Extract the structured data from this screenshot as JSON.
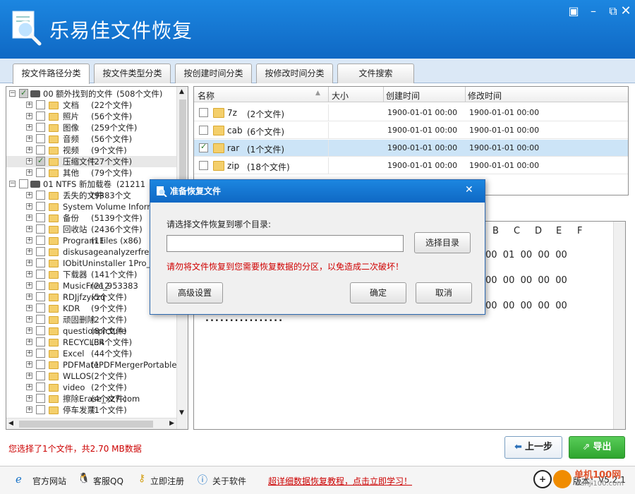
{
  "app": {
    "title": "乐易佳文件恢复"
  },
  "tabs": [
    "按文件路径分类",
    "按文件类型分类",
    "按创建时间分类",
    "按修改时间分类",
    "文件搜索"
  ],
  "tree": [
    {
      "id": "00",
      "label": "00",
      "name": "额外找到的文件",
      "count": "(508个文件)",
      "indent": 0,
      "check": "partial",
      "exp": "−"
    },
    {
      "name": "文档",
      "count": "(22个文件)",
      "indent": 1,
      "check": "",
      "exp": "+"
    },
    {
      "name": "照片",
      "count": "(56个文件)",
      "indent": 1,
      "check": "",
      "exp": "+"
    },
    {
      "name": "图像",
      "count": "(259个文件)",
      "indent": 1,
      "check": "",
      "exp": "+"
    },
    {
      "name": "音频",
      "count": "(56个文件)",
      "indent": 1,
      "check": "",
      "exp": "+"
    },
    {
      "name": "视频",
      "count": "(9个文件)",
      "indent": 1,
      "check": "",
      "exp": "+"
    },
    {
      "name": "压缩文件",
      "count": "(27个文件)",
      "indent": 1,
      "check": "partial",
      "exp": "+",
      "sel": true
    },
    {
      "name": "其他",
      "count": "(79个文件)",
      "indent": 1,
      "check": "",
      "exp": "+"
    },
    {
      "label": "01",
      "name": "NTFS  新加载卷",
      "count": "(21211",
      "indent": 0,
      "check": "",
      "exp": "−"
    },
    {
      "name": "丢失的文件",
      "count": "(9383个文",
      "indent": 1,
      "check": "",
      "exp": "+"
    },
    {
      "name": "System Volume Informatio",
      "count": "",
      "indent": 1,
      "check": "",
      "exp": "+"
    },
    {
      "name": "备份",
      "count": "(5139个文件)",
      "indent": 1,
      "check": "",
      "exp": "+"
    },
    {
      "name": "回收站",
      "count": "(2436个文件)",
      "indent": 1,
      "check": "",
      "exp": "+"
    },
    {
      "name": "Program Files (x86)",
      "count": "(11",
      "indent": 1,
      "check": "",
      "exp": "+"
    },
    {
      "name": "diskusageanalyzerfree19",
      "count": "",
      "indent": 1,
      "check": "",
      "exp": "+"
    },
    {
      "name": "IObitUninstaller 1Pro_xz7.c",
      "count": "",
      "indent": 1,
      "check": "",
      "exp": "+"
    },
    {
      "name": "下载器",
      "count": "(141个文件)",
      "indent": 1,
      "check": "",
      "exp": "+"
    },
    {
      "name": "MusicFree_953383",
      "count": "(212",
      "indent": 1,
      "check": "",
      "exp": "+"
    },
    {
      "name": "RDJjfzyxzq",
      "count": "(5个文件)",
      "indent": 1,
      "check": "",
      "exp": "+"
    },
    {
      "name": "KDR",
      "count": "(9个文件)",
      "indent": 1,
      "check": "",
      "exp": "+"
    },
    {
      "name": "顽固删除",
      "count": "(2个文件)",
      "indent": 1,
      "check": "",
      "exp": "+"
    },
    {
      "name": "questionpicture",
      "count": "(8个文件)",
      "indent": 1,
      "check": "",
      "exp": "+"
    },
    {
      "name": "RECYCLER",
      "count": "(34个文件)",
      "indent": 1,
      "check": "",
      "exp": "+"
    },
    {
      "name": "Excel",
      "count": "(44个文件)",
      "indent": 1,
      "check": "",
      "exp": "+"
    },
    {
      "name": "PDFMatePDFMergerPortable",
      "count": "(1",
      "indent": 1,
      "check": "",
      "exp": "+"
    },
    {
      "name": "WLLOS",
      "count": "(2个文件)",
      "indent": 1,
      "check": "",
      "exp": "+"
    },
    {
      "name": "video",
      "count": "(2个文件)",
      "indent": 1,
      "check": "",
      "exp": "+"
    },
    {
      "name": "擦除Erase_xz7.com",
      "count": "(4个文件)",
      "indent": 1,
      "check": "",
      "exp": "+"
    },
    {
      "name": "停车发票",
      "count": "(1个文件)",
      "indent": 1,
      "check": "",
      "exp": "+"
    }
  ],
  "filelist": {
    "headers": [
      "名称",
      "大小",
      "创建时间",
      "修改时间"
    ],
    "rows": [
      {
        "name": "7z",
        "count": "(2个文件)",
        "created": "1900-01-01  00:00",
        "modified": "1900-01-01  00:00",
        "checked": false,
        "sel": false
      },
      {
        "name": "cab",
        "count": "(6个文件)",
        "created": "1900-01-01  00:00",
        "modified": "1900-01-01  00:00",
        "checked": false,
        "sel": false
      },
      {
        "name": "rar",
        "count": "(1个文件)",
        "created": "1900-01-01  00:00",
        "modified": "1900-01-01  00:00",
        "checked": true,
        "sel": true
      },
      {
        "name": "zip",
        "count": "(18个文件)",
        "created": "1900-01-01  00:00",
        "modified": "1900-01-01  00:00",
        "checked": false,
        "sel": false
      }
    ]
  },
  "hex": {
    "headers": [
      "B",
      "C",
      "D",
      "E",
      "F"
    ],
    "rows": [
      "00  01  00  00  00",
      "00  00  00  00  00",
      "00  00  00  00  00"
    ],
    "dots": "................"
  },
  "status": "您选择了1个文件，共2.70 MB数据",
  "nav": {
    "prev": "上一步",
    "export": "导出"
  },
  "bottom": {
    "site": "官方网站",
    "qq": "客服QQ",
    "register": "立即注册",
    "about": "关于软件",
    "promo": "超详细数据恢复教程，点击立即学习！",
    "version_label": "版本：",
    "version": "V5.2.1"
  },
  "watermark": {
    "name": "单机100网",
    "url": "danji100.com"
  },
  "dialog": {
    "title": "准备恢复文件",
    "prompt": "请选择文件恢复到哪个目录:",
    "path_value": "",
    "choose": "选择目录",
    "warning": "请勿将文件恢复到您需要恢复数据的分区，以免造成二次破坏！",
    "advanced": "高级设置",
    "ok": "确定",
    "cancel": "取消"
  },
  "colors": {
    "titlebar": "#1478d4",
    "accent": "#1a74c8",
    "warning": "#cc0000",
    "export": "#3ab83a"
  }
}
